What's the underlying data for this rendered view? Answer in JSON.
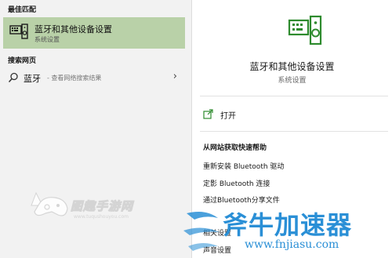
{
  "left": {
    "best_match_label": "最佳匹配",
    "best_match": {
      "title": "蓝牙和其他设备设置",
      "subtitle": "系统设置",
      "icon": "keyboard-speaker-icon"
    },
    "web_label": "搜索网页",
    "web": {
      "query": "蓝牙",
      "hint": "- 查看网络搜索结果",
      "icon": "search-icon",
      "chevron": "›"
    }
  },
  "right": {
    "title": "蓝牙和其他设备设置",
    "subtitle": "系统设置",
    "open_label": "打开",
    "help_title": "从网站获取快速帮助",
    "links": [
      "重新安装 Bluetooth 驱动",
      "定影 Bluetooth 连接",
      "通过Bluetooth分享文件",
      "相关设置",
      "声音设置"
    ]
  },
  "watermarks": {
    "left_text": "图趣手游网",
    "left_url": "www.tuqushouyou.com",
    "right_brand": "斧牛加速器",
    "right_url": "www.fnjiasu.com"
  },
  "colors": {
    "accent_green": "#2e8b2e",
    "selection_bg": "#b9d1a8",
    "watermark_blue": "#2a8fd6"
  }
}
